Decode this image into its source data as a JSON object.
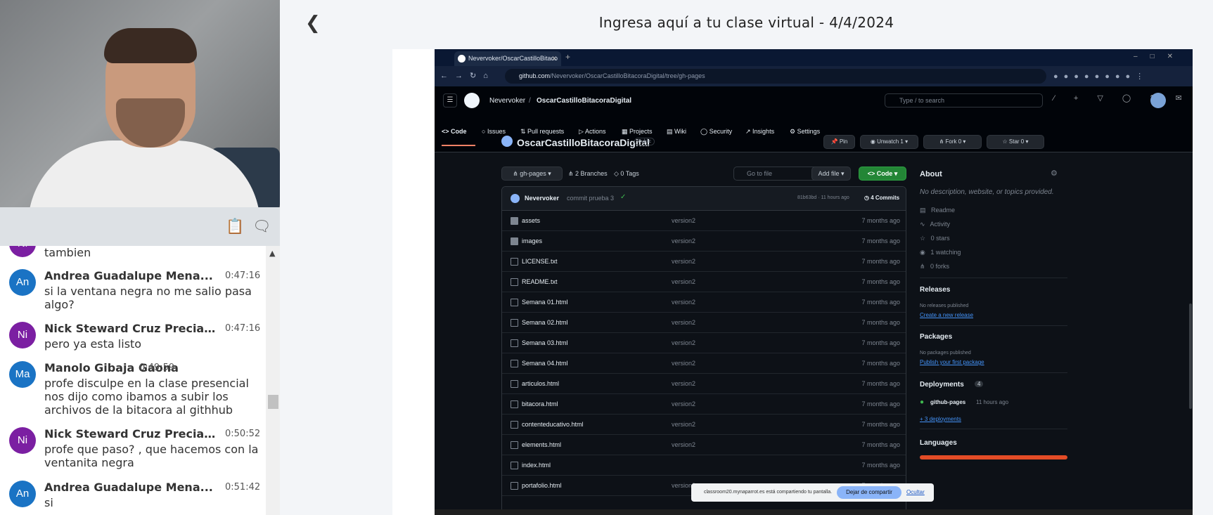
{
  "page": {
    "title": "Ingresa aquí a tu clase virtual - 4/4/2024",
    "back_icon": "chevron-left-icon"
  },
  "chat": {
    "partial_top_text": "tambien",
    "messages": [
      {
        "initials": "An",
        "color": "#1a73c4",
        "name": "Andrea Guadalupe Mena...",
        "time": "0:47:16",
        "text": "si la ventana negra no me salio pasa algo?"
      },
      {
        "initials": "Ni",
        "color": "#7b1fa2",
        "name": "Nick Steward Cruz Precia...",
        "time": "0:47:16",
        "text": "pero ya esta listo"
      },
      {
        "initials": "Ma",
        "color": "#1a73c4",
        "name": "Manolo Gibaja Gaona",
        "time": "0:49:59",
        "text": "profe disculpe en la clase presencial nos dijo como ibamos a subir los archivos de la bitacora al githhub"
      },
      {
        "initials": "Ni",
        "color": "#7b1fa2",
        "name": "Nick Steward Cruz Precia...",
        "time": "0:50:52",
        "text": "profe que paso? , que hacemos con la ventanita negra"
      },
      {
        "initials": "An",
        "color": "#1a73c4",
        "name": "Andrea Guadalupe Mena...",
        "time": "0:51:42",
        "text": "si"
      }
    ],
    "toolbar_icons": [
      "clipboard-icon",
      "chat-bubbles-icon"
    ]
  },
  "browser": {
    "tab_title": "Nevervoker/OscarCastilloBitaco",
    "url_host": "github.com",
    "url_path": "/Nevervoker/OscarCastilloBitacoraDigital/tree/gh-pages"
  },
  "github": {
    "owner": "Nevervoker",
    "separator": "/",
    "repo": "OscarCastilloBitacoraDigital",
    "search_placeholder": "Type / to search",
    "nav": [
      "Code",
      "Issues",
      "Pull requests",
      "Actions",
      "Projects",
      "Wiki",
      "Security",
      "Insights",
      "Settings"
    ],
    "visibility": "Public",
    "pin": "Pin",
    "unwatch": "Unwatch",
    "unwatch_count": "1",
    "fork": "Fork",
    "fork_count": "0",
    "star": "Star",
    "star_count": "0",
    "branch": "gh-pages",
    "branches": "2 Branches",
    "tags": "0 Tags",
    "goto_file": "Go to file",
    "add_file": "Add file",
    "code_btn": "Code",
    "commit": {
      "author": "Nevervoker",
      "message": "commit prueba 3",
      "hash": "81b63bd · 11 hours ago",
      "count": "4 Commits"
    },
    "files": [
      {
        "name": "assets",
        "type": "dir",
        "msg": "version2",
        "age": "7 months ago"
      },
      {
        "name": "images",
        "type": "dir",
        "msg": "version2",
        "age": "7 months ago"
      },
      {
        "name": "LICENSE.txt",
        "type": "file",
        "msg": "version2",
        "age": "7 months ago"
      },
      {
        "name": "README.txt",
        "type": "file",
        "msg": "version2",
        "age": "7 months ago"
      },
      {
        "name": "Semana 01.html",
        "type": "file",
        "msg": "version2",
        "age": "7 months ago"
      },
      {
        "name": "Semana 02.html",
        "type": "file",
        "msg": "version2",
        "age": "7 months ago"
      },
      {
        "name": "Semana 03.html",
        "type": "file",
        "msg": "version2",
        "age": "7 months ago"
      },
      {
        "name": "Semana 04.html",
        "type": "file",
        "msg": "version2",
        "age": "7 months ago"
      },
      {
        "name": "articulos.html",
        "type": "file",
        "msg": "version2",
        "age": "7 months ago"
      },
      {
        "name": "bitacora.html",
        "type": "file",
        "msg": "version2",
        "age": "7 months ago"
      },
      {
        "name": "contenteducativo.html",
        "type": "file",
        "msg": "version2",
        "age": "7 months ago"
      },
      {
        "name": "elements.html",
        "type": "file",
        "msg": "version2",
        "age": "7 months ago"
      },
      {
        "name": "index.html",
        "type": "file",
        "msg": "",
        "age": "7 months ago"
      },
      {
        "name": "portafolio.html",
        "type": "file",
        "msg": "version2",
        "age": "7 months ago"
      }
    ],
    "about": {
      "title": "About",
      "description": "No description, website, or topics provided.",
      "readme": "Readme",
      "activity": "Activity",
      "stars": "0 stars",
      "watching": "1 watching",
      "forks": "0 forks",
      "releases_title": "Releases",
      "releases_text": "No releases published",
      "releases_link": "Create a new release",
      "packages_title": "Packages",
      "packages_text": "No packages published",
      "packages_link": "Publish your first package",
      "deployments_title": "Deployments",
      "deployments_count": "4",
      "deploy_env": "github-pages",
      "deploy_time": "11 hours ago",
      "deploy_more": "+ 3 deployments",
      "languages_title": "Languages"
    }
  },
  "sharebar": {
    "text": "classroom20.mynaparrot.es está compartiendo tu pantalla.",
    "stop": "Dejar de compartir",
    "hide": "Ocultar"
  }
}
